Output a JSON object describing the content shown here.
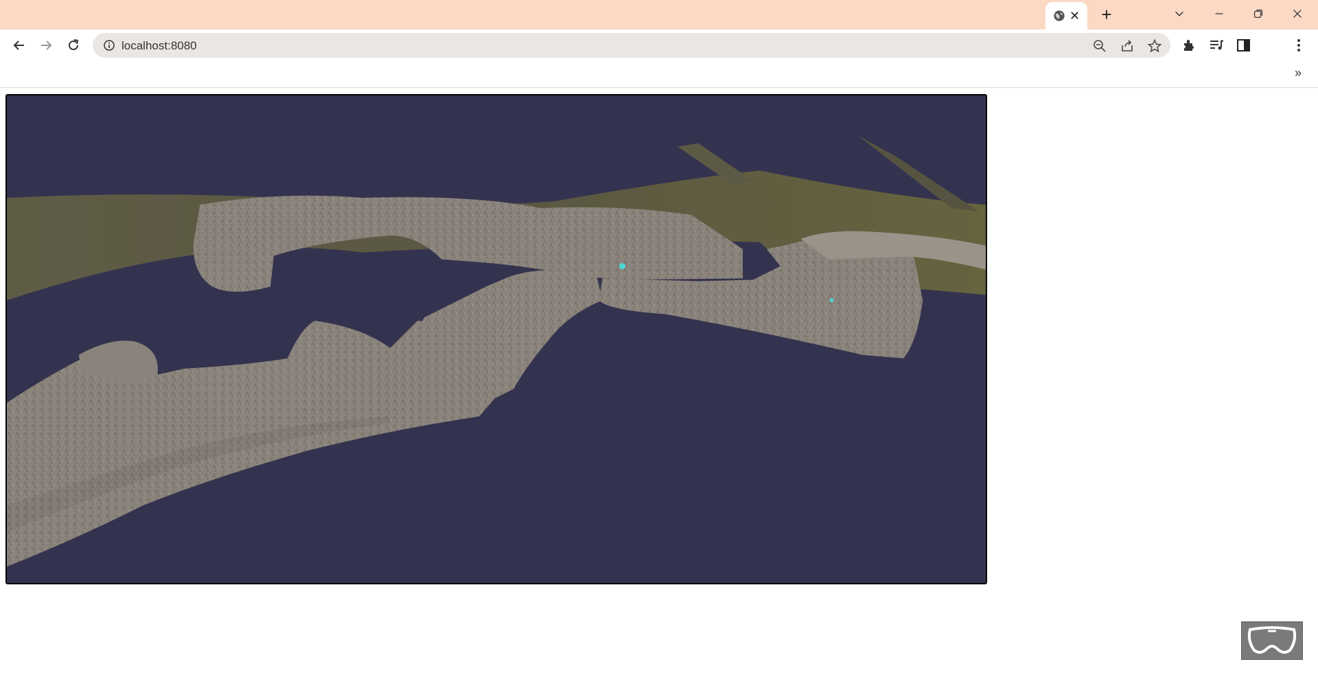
{
  "browser": {
    "url": "localhost:8080",
    "tab_close": "✕",
    "new_tab": "+",
    "bookmarks_more": "»"
  },
  "scene": {
    "background_color": "#34334f",
    "terrain_color": "#5b5842",
    "rock_color": "#8b847c",
    "marker_color": "#4fd6d6"
  },
  "icons": [
    "globe-icon",
    "back-icon",
    "forward-icon",
    "reload-icon",
    "info-icon",
    "zoom-out-icon",
    "share-icon",
    "star-icon",
    "extensions-icon",
    "reading-list-icon",
    "side-panel-icon",
    "menu-icon",
    "vr-headset-icon"
  ]
}
